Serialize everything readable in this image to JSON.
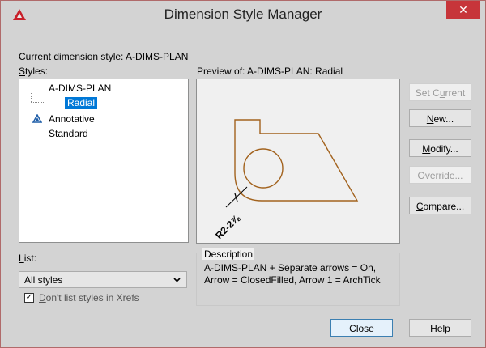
{
  "window": {
    "title": "Dimension Style Manager",
    "close_glyph": "✕"
  },
  "current_style": {
    "label": "Current dimension style: A-DIMS-PLAN"
  },
  "styles": {
    "label_prefix": "",
    "label_underlined": "S",
    "label_suffix": "tyles:",
    "items": [
      {
        "name": "A-DIMS-PLAN"
      },
      {
        "name": "Radial"
      },
      {
        "name": "Annotative"
      },
      {
        "name": "Standard"
      }
    ]
  },
  "preview": {
    "label": "Preview of: A-DIMS-PLAN: Radial",
    "dim_text": "R2-2⅞"
  },
  "buttons": {
    "set_current": {
      "pre": "Set C",
      "ul": "u",
      "post": "rrent"
    },
    "new": {
      "pre": "",
      "ul": "N",
      "post": "ew..."
    },
    "modify": {
      "pre": "",
      "ul": "M",
      "post": "odify..."
    },
    "override": {
      "pre": "",
      "ul": "O",
      "post": "verride..."
    },
    "compare": {
      "pre": "",
      "ul": "C",
      "post": "ompare..."
    },
    "close": "Close",
    "help": {
      "pre": "",
      "ul": "H",
      "post": "elp"
    }
  },
  "list": {
    "label_ul": "L",
    "label_rest": "ist:",
    "selected": "All styles"
  },
  "xrefs": {
    "ul": "D",
    "rest": "on't list styles in Xrefs",
    "checked": "✓"
  },
  "description": {
    "label": "Description",
    "line1": "A-DIMS-PLAN + Separate arrows = On,",
    "line2": "Arrow = ClosedFilled, Arrow 1 = ArchTick"
  },
  "colors": {
    "accent": "#0078d7",
    "close_red": "#c7353a",
    "drawing": "#a2621d"
  }
}
